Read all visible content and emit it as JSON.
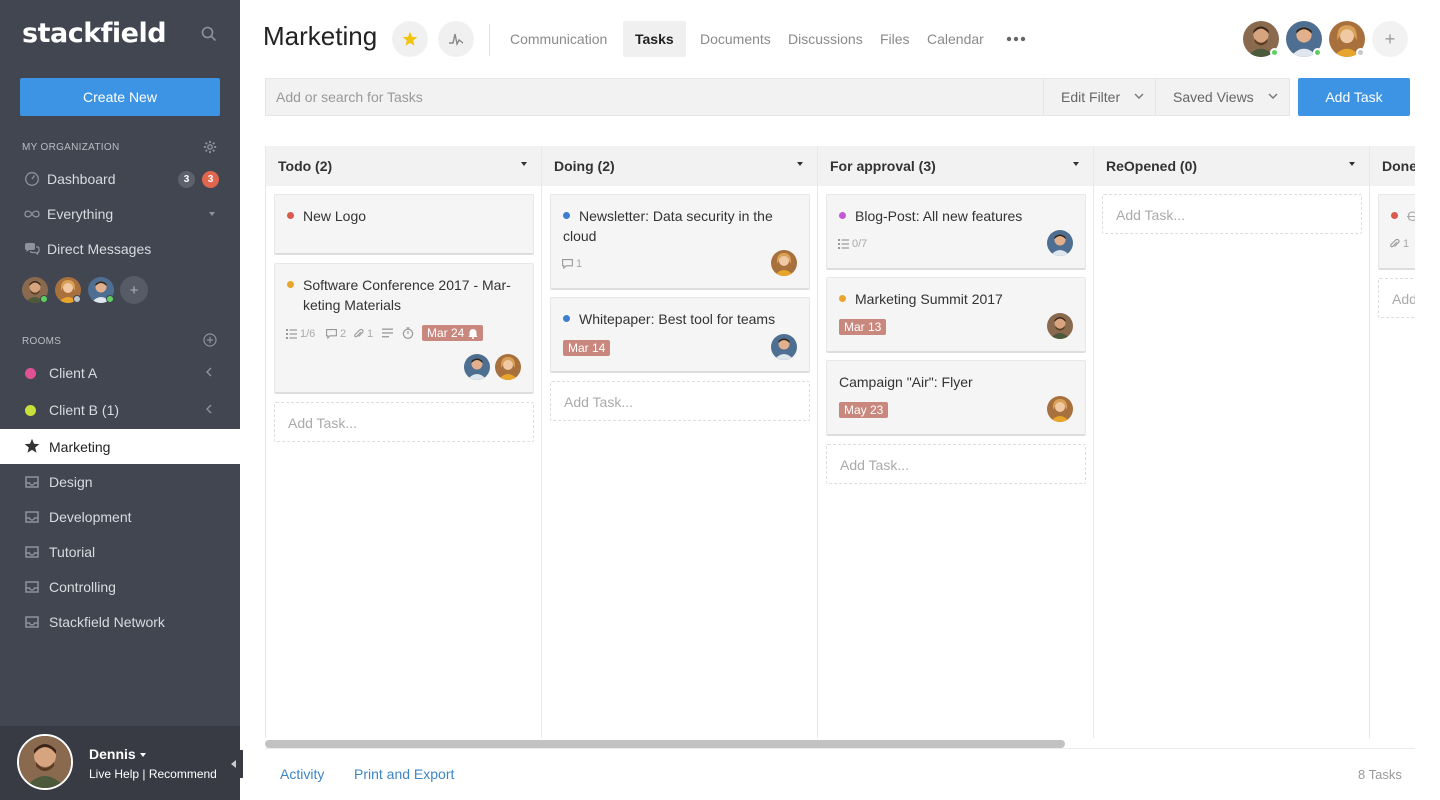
{
  "sidebar": {
    "logo": "stackfield",
    "create_new": "Create New",
    "org_label": "MY ORGANIZATION",
    "nav": {
      "dashboard": "Dashboard",
      "dashboard_badge_1": "3",
      "dashboard_badge_2": "3",
      "everything": "Everything",
      "direct_messages": "Direct Messages"
    },
    "add_member": "+",
    "rooms_label": "ROOMS",
    "rooms": [
      {
        "label": "Client A",
        "color": "#e05293"
      },
      {
        "label": "Client B (1)",
        "color": "#c8e03a"
      },
      {
        "label": "Marketing"
      },
      {
        "label": "Design"
      },
      {
        "label": "Development"
      },
      {
        "label": "Tutorial"
      },
      {
        "label": "Controlling"
      },
      {
        "label": "Stackfield Network"
      }
    ],
    "user": {
      "name": "Dennis",
      "links": "Live Help | Recommend"
    }
  },
  "header": {
    "title": "Marketing",
    "tabs": [
      "Communication",
      "Tasks",
      "Documents",
      "Discussions",
      "Files",
      "Calendar"
    ],
    "active_tab": "Tasks",
    "add_member": "+"
  },
  "toolbar": {
    "search_placeholder": "Add or search for Tasks",
    "edit_filter": "Edit Filter",
    "saved_views": "Saved Views",
    "add_task": "Add Task"
  },
  "board": {
    "add_task_placeholder": "Add Task...",
    "columns": [
      {
        "title": "Todo (2)",
        "cards": [
          {
            "title": "New Logo",
            "dot": "#d65a4e"
          },
          {
            "title": "Software Conference 2017 - Mar-keting Materials",
            "dot": "#e8a52b",
            "checklist": "1/6",
            "comments": "2",
            "attachments": "1",
            "date": "Mar 24"
          }
        ]
      },
      {
        "title": "Doing (2)",
        "cards": [
          {
            "title": "Newsletter: Data security in the cloud",
            "dot": "#3d7ecf",
            "comments": "1"
          },
          {
            "title": "Whitepaper: Best tool for teams",
            "dot": "#3d7ecf",
            "date": "Mar 14"
          }
        ]
      },
      {
        "title": "For approval (3)",
        "cards": [
          {
            "title": "Blog-Post: All new features",
            "dot": "#c459d6",
            "checklist": "0/7"
          },
          {
            "title": "Marketing Summit 2017",
            "dot": "#e8a52b",
            "date": "Mar 13"
          },
          {
            "title": "Campaign \"Air\": Flyer",
            "date": "May 23"
          }
        ]
      },
      {
        "title": "ReOpened (0)",
        "cards": []
      },
      {
        "title": "Done",
        "cards": [
          {
            "title": "G",
            "dot": "#d65a4e",
            "attachments": "1"
          }
        ],
        "add_task_placeholder": "Add"
      }
    ]
  },
  "footer": {
    "activity": "Activity",
    "print_export": "Print and Export",
    "task_count": "8 Tasks"
  }
}
